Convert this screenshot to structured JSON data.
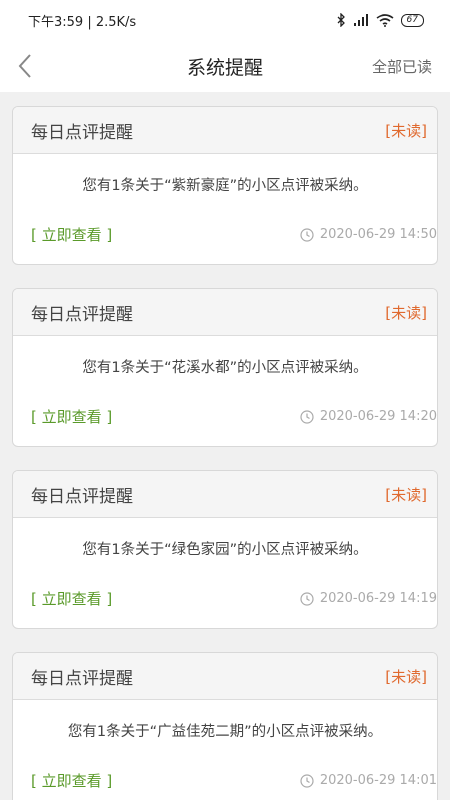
{
  "status": {
    "time_speed": "下午3:59 | 2.5K/s",
    "battery": "67",
    "icons": [
      "bluetooth-icon",
      "signal-icon",
      "wifi-icon",
      "battery-icon"
    ]
  },
  "navbar": {
    "title": "系统提醒",
    "action": "全部已读",
    "back_icon": "chevron-left-icon"
  },
  "colors": {
    "unread": "#e0692e",
    "link": "#5a9a2a",
    "time": "#aaaaaa",
    "background": "#f0f0f0"
  },
  "notifications": [
    {
      "title": "每日点评提醒",
      "status": "[未读]",
      "message": "您有1条关于“紫新豪庭”的小区点评被采纳。",
      "link": "[ 立即查看 ]",
      "time": "2020-06-29 14:50"
    },
    {
      "title": "每日点评提醒",
      "status": "[未读]",
      "message": "您有1条关于“花溪水都”的小区点评被采纳。",
      "link": "[ 立即查看 ]",
      "time": "2020-06-29 14:20"
    },
    {
      "title": "每日点评提醒",
      "status": "[未读]",
      "message": "您有1条关于“绿色家园”的小区点评被采纳。",
      "link": "[ 立即查看 ]",
      "time": "2020-06-29 14:19"
    },
    {
      "title": "每日点评提醒",
      "status": "[未读]",
      "message": "您有1条关于“广益佳苑二期”的小区点评被采纳。",
      "link": "[ 立即查看 ]",
      "time": "2020-06-29 14:01"
    }
  ]
}
